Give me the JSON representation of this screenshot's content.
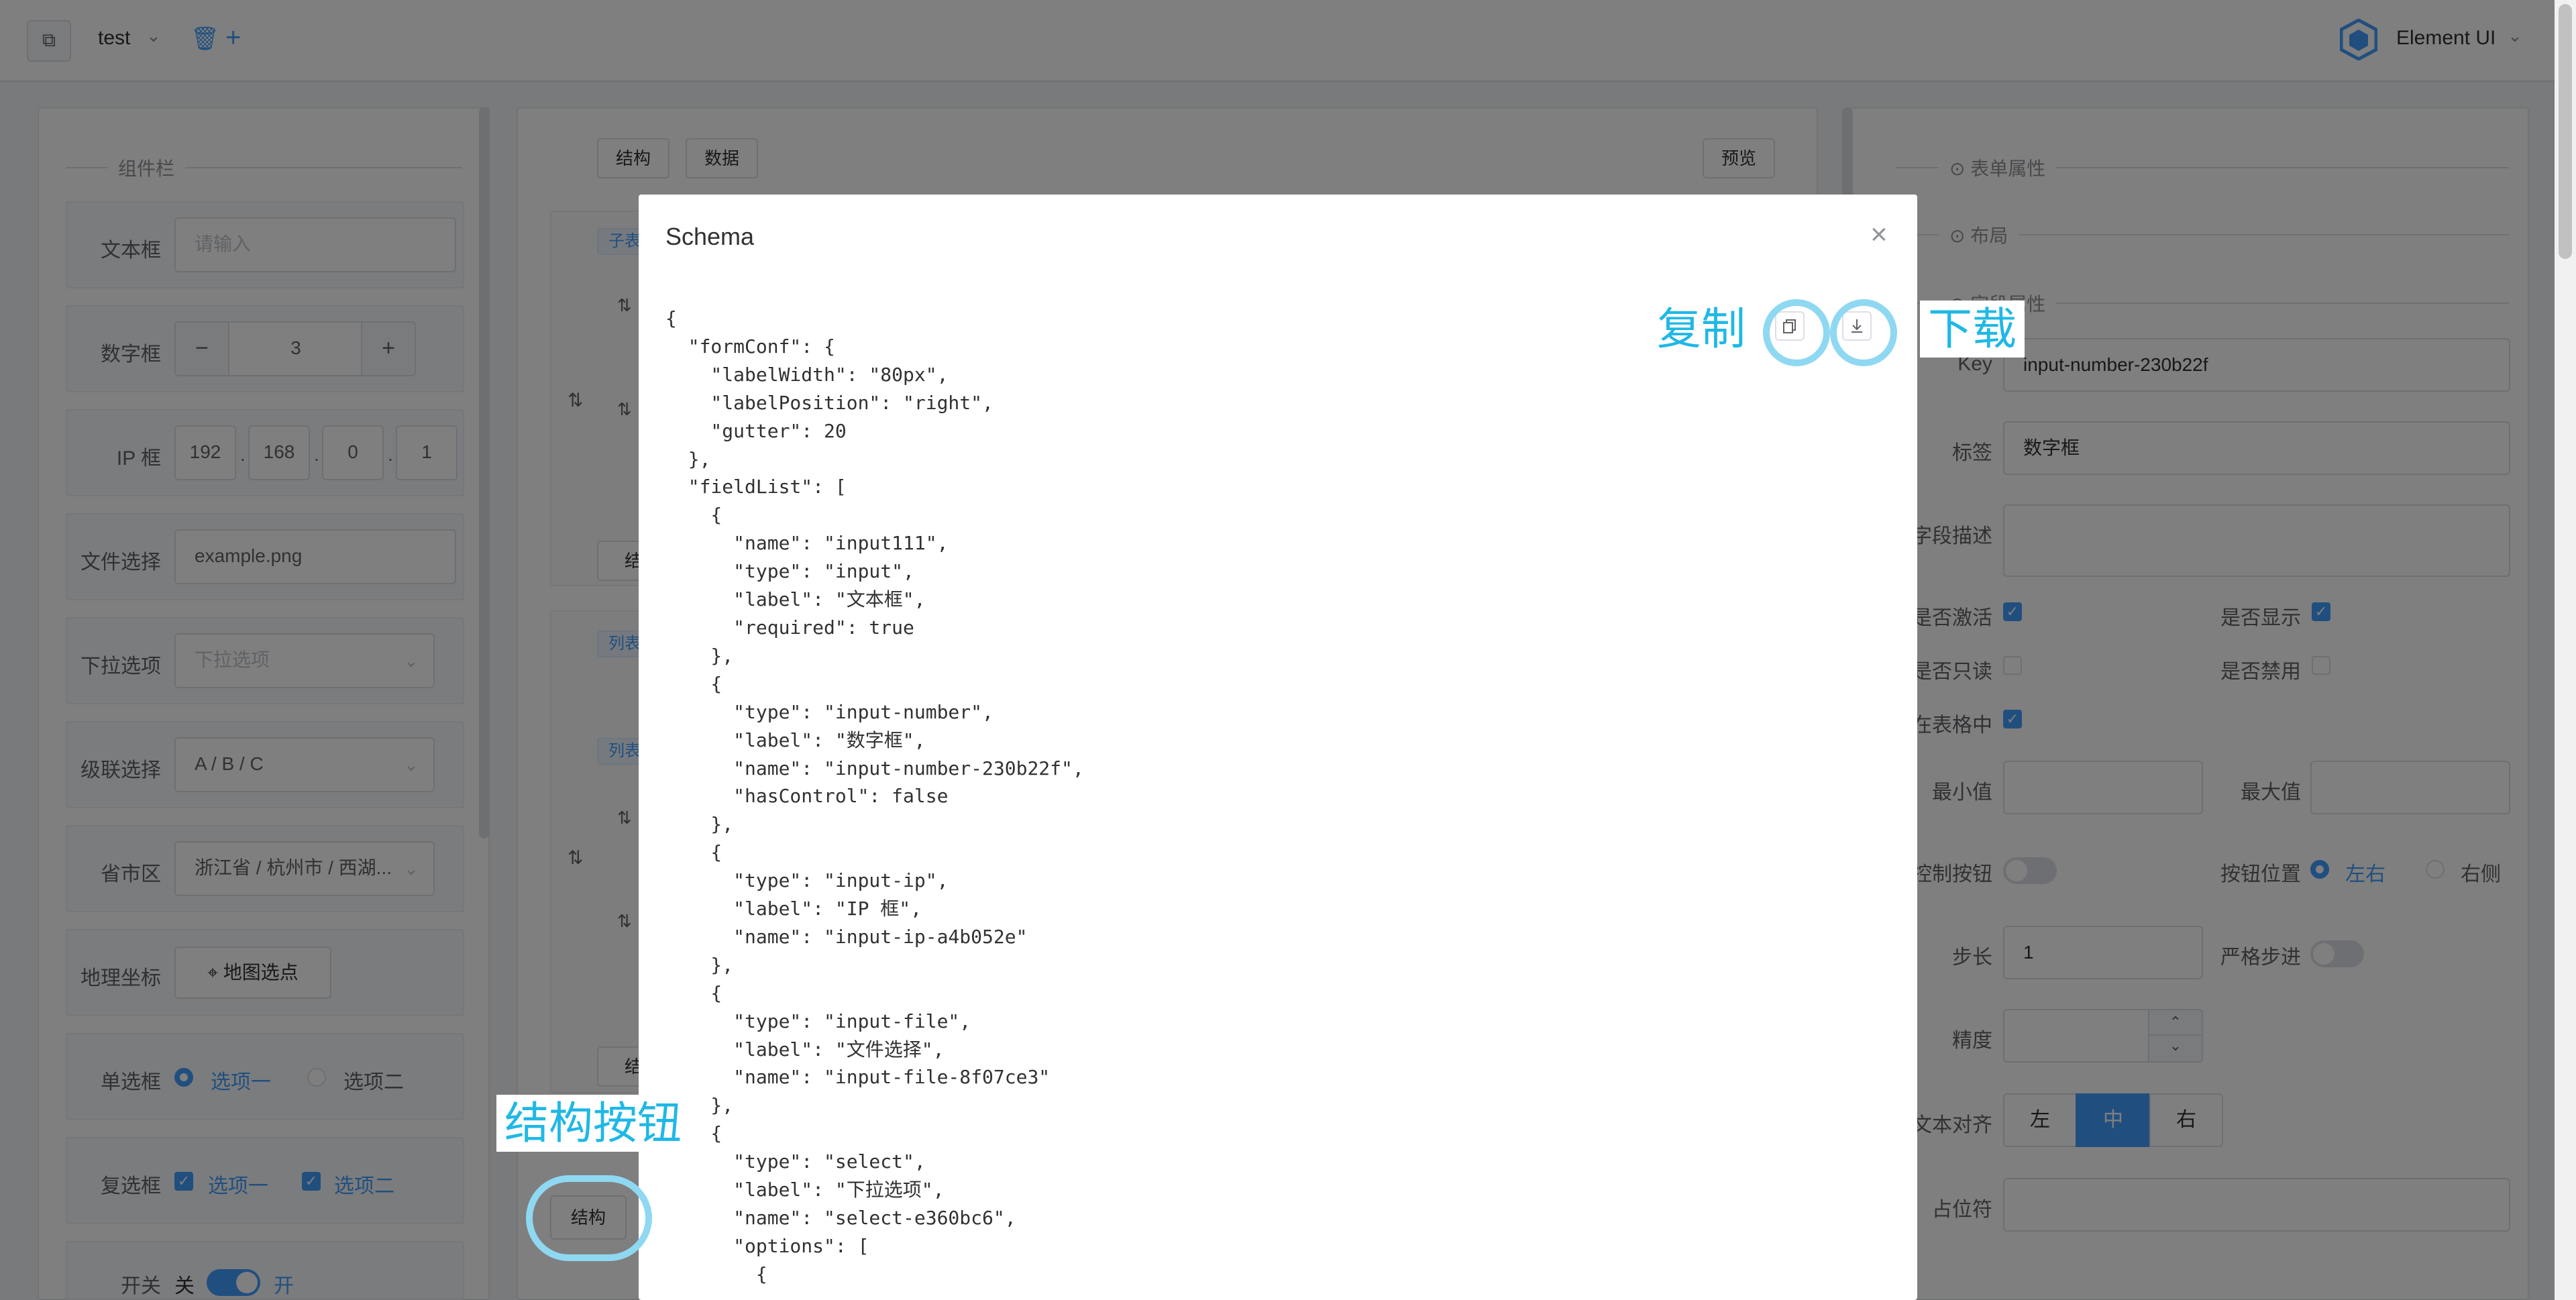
{
  "header": {
    "project_name": "test",
    "brand": "Element UI"
  },
  "components_panel": {
    "title": "组件栏",
    "rows": [
      {
        "label": "文本框",
        "placeholder": "请输入"
      },
      {
        "label": "数字框",
        "minus": "−",
        "value": "3",
        "plus": "+"
      },
      {
        "label": "IP 框",
        "octets": [
          "192",
          "168",
          "0",
          "1"
        ],
        "sep": "."
      },
      {
        "label": "文件选择",
        "value": "example.png"
      },
      {
        "label": "下拉选项",
        "placeholder": "下拉选项"
      },
      {
        "label": "级联选择",
        "value": "A / B / C"
      },
      {
        "label": "省市区",
        "value": "浙江省 / 杭州市 / 西湖..."
      },
      {
        "label": "地理坐标",
        "button": "地图选点"
      },
      {
        "label": "单选框",
        "option1": "选项一",
        "option2": "选项二"
      },
      {
        "label": "复选框",
        "option1": "选项一",
        "option2": "选项二"
      },
      {
        "label": "开关",
        "off": "关",
        "on": "开"
      }
    ]
  },
  "canvas": {
    "structure_button": "结构",
    "data_button": "数据",
    "preview_button": "预览",
    "tag_subtable": "子表",
    "tag_list1": "列表",
    "tag_list2": "列表",
    "bottom_structure_button": "结构",
    "small_btn_1": "结",
    "small_btn_2": "结"
  },
  "properties_panel": {
    "section_form": "表单属性",
    "section_layout": "布局",
    "section_field": "字段属性",
    "key_label": "Key",
    "key_value": "input-number-230b22f",
    "title_label": "标签",
    "title_value": "数字框",
    "desc_label": "字段描述",
    "active_label": "是否激活",
    "visible_label": "是否显示",
    "readonly_label": "是否只读",
    "disabled_label": "是否禁用",
    "in_table_label": "在表格中",
    "min_label": "最小值",
    "max_label": "最大值",
    "control_btn_label": "控制按钮",
    "btn_pos_label": "按钮位置",
    "pos_left": "左右",
    "pos_right": "右侧",
    "step_label": "步长",
    "step_value": "1",
    "strict_label": "严格步进",
    "precision_label": "精度",
    "align_label": "文本对齐",
    "align_left": "左",
    "align_center": "中",
    "align_right": "右",
    "placeholder_label": "占位符"
  },
  "modal": {
    "title": "Schema",
    "close": "×",
    "code": "{\n  \"formConf\": {\n    \"labelWidth\": \"80px\",\n    \"labelPosition\": \"right\",\n    \"gutter\": 20\n  },\n  \"fieldList\": [\n    {\n      \"name\": \"input111\",\n      \"type\": \"input\",\n      \"label\": \"文本框\",\n      \"required\": true\n    },\n    {\n      \"type\": \"input-number\",\n      \"label\": \"数字框\",\n      \"name\": \"input-number-230b22f\",\n      \"hasControl\": false\n    },\n    {\n      \"type\": \"input-ip\",\n      \"label\": \"IP 框\",\n      \"name\": \"input-ip-a4b052e\"\n    },\n    {\n      \"type\": \"input-file\",\n      \"label\": \"文件选择\",\n      \"name\": \"input-file-8f07ce3\"\n    },\n    {\n      \"type\": \"select\",\n      \"label\": \"下拉选项\",\n      \"name\": \"select-e360bc6\",\n      \"options\": [\n        {"
  },
  "annotations": {
    "copy": "复制",
    "download": "下载",
    "structure_button": "结构按钮"
  },
  "colors": {
    "accent": "#409eff",
    "annotation": "#1fb8e6"
  }
}
